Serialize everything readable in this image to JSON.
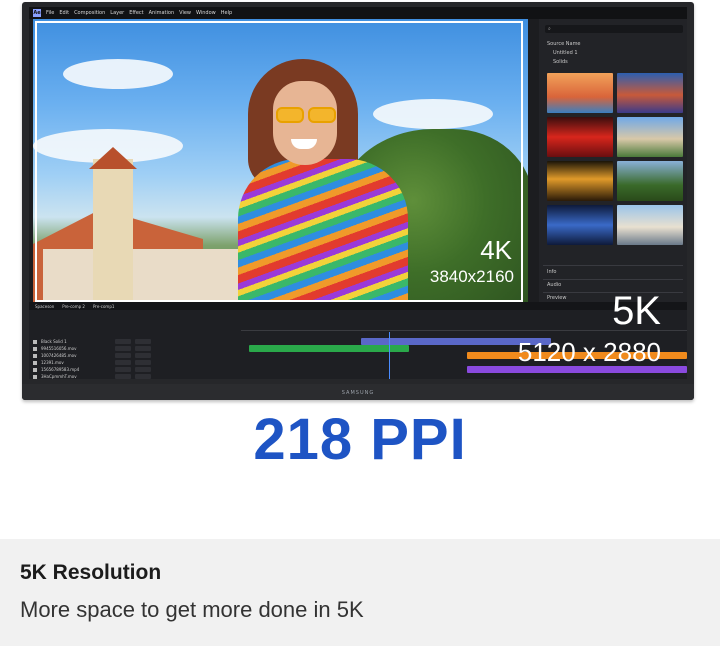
{
  "menubar": {
    "logo": "Ae",
    "items": [
      "File",
      "Edit",
      "Composition",
      "Layer",
      "Effect",
      "Animation",
      "View",
      "Window",
      "Help"
    ]
  },
  "overlay": {
    "label_4k": "4K",
    "res_4k": "3840x2160",
    "label_5k": "5K",
    "res_5k": "5120 x 2880"
  },
  "panel": {
    "search_placeholder": "⌕",
    "source_name": "Source Name",
    "tree_items": [
      "Untitled 1",
      "Solids"
    ],
    "sections": [
      "Info",
      "Audio",
      "Preview"
    ]
  },
  "timeline": {
    "tabs": [
      "Spaceson",
      "Pre-comp 2",
      "Pre-comp1"
    ],
    "layers": [
      "Black Solid 1",
      "9945516056.mov",
      "1007426485.mov",
      "12391.mov",
      "15656789583.mp4",
      "3HaCpmmhT.mov"
    ]
  },
  "monitor": {
    "brand": "SAMSUNG"
  },
  "headline": "218 PPI",
  "footer": {
    "title": "5K Resolution",
    "subtitle": "More space to get more done in 5K"
  },
  "colors": {
    "accent": "#1e54c4",
    "timeline_green": "#2aa84a",
    "timeline_orange": "#f08a1c",
    "timeline_purple": "#8a4adf",
    "timeline_blue": "#5a68c8"
  }
}
